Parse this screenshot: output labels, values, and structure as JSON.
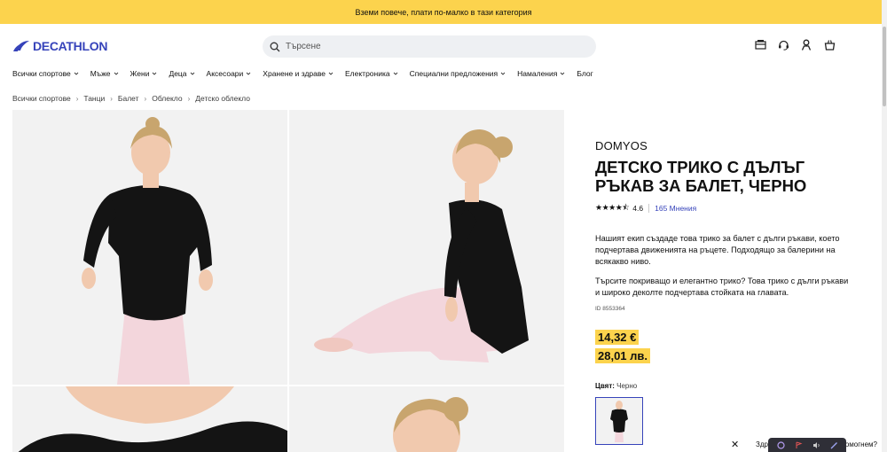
{
  "promo": {
    "text": "Вземи повече, плати по-малко в тази категория"
  },
  "header": {
    "logo_text": "DECATHLON",
    "search_placeholder": "Търсене",
    "icons": [
      "store-icon",
      "help-icon",
      "account-icon",
      "cart-icon"
    ]
  },
  "nav": {
    "items": [
      {
        "label": "Всички спортове",
        "has_dropdown": true
      },
      {
        "label": "Мъже",
        "has_dropdown": true
      },
      {
        "label": "Жени",
        "has_dropdown": true
      },
      {
        "label": "Деца",
        "has_dropdown": true
      },
      {
        "label": "Аксесоари",
        "has_dropdown": true
      },
      {
        "label": "Хранене и здраве",
        "has_dropdown": true
      },
      {
        "label": "Електроника",
        "has_dropdown": true
      },
      {
        "label": "Специални предложения",
        "has_dropdown": true
      },
      {
        "label": "Намаления",
        "has_dropdown": true
      },
      {
        "label": "Блог",
        "has_dropdown": false
      }
    ]
  },
  "breadcrumb": [
    "Всички спортове",
    "Танци",
    "Балет",
    "Облекло",
    "Детско облекло"
  ],
  "product": {
    "brand": "DOMYOS",
    "title": "ДЕТСКО ТРИКО С ДЪЛЪГ РЪКАВ ЗА БАЛЕТ, ЧЕРНО",
    "rating": "4.6",
    "rating_stars": 4.5,
    "reviews": "165 Мнения",
    "description": "Нашият екип създаде това трико за балет с дълги ръкави, което подчертава движенията на ръцете. Подходящо за балерини на всякакво ниво.",
    "description2": "Търсите покриващо и елегантно трико? Това трико с дълги ръкави и широко деколте подчертава стойката на главата.",
    "id_text": "ID 8553364",
    "price_eur": "14,32 €",
    "price_bgn": "28,01 лв.",
    "color_label": "Цвят:",
    "color_value": "Черно"
  },
  "chat": {
    "text": "Здравейте, как можем да помогнем?"
  },
  "colors": {
    "accent": "#3643ba",
    "promo": "#fcd34d",
    "leotard": "#141414",
    "tights": "#f3d6dc",
    "skin": "#f1c9ae",
    "hair": "#c8a56e"
  }
}
